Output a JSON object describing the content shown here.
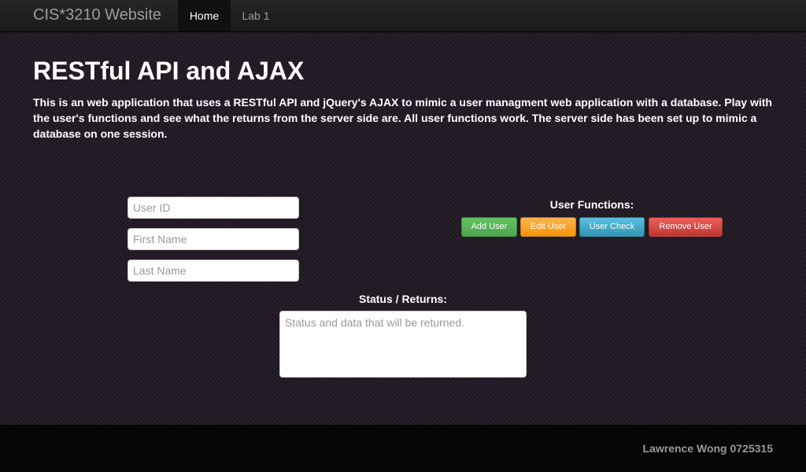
{
  "navbar": {
    "brand": "CIS*3210 Website",
    "items": [
      {
        "label": "Home",
        "active": true
      },
      {
        "label": "Lab 1",
        "active": false
      }
    ]
  },
  "main": {
    "title": "RESTful API and AJAX",
    "description": "This is an web application that uses a RESTful API and jQuery's AJAX to mimic a user managment web application with a database. Play with the user's functions and see what the returns from the server side are. All user functions work. The server side has been set up to mimic a database on one session."
  },
  "form": {
    "user_id": {
      "placeholder": "User ID",
      "value": ""
    },
    "first_name": {
      "placeholder": "First Name",
      "value": ""
    },
    "last_name": {
      "placeholder": "Last Name",
      "value": ""
    }
  },
  "user_functions": {
    "label": "User Functions:",
    "buttons": [
      {
        "label": "Add User",
        "color": "#5bb75b"
      },
      {
        "label": "Edit User",
        "color": "#faa732"
      },
      {
        "label": "User Check",
        "color": "#49afcd"
      },
      {
        "label": "Remove User",
        "color": "#da4f49"
      }
    ]
  },
  "status": {
    "label": "Status / Returns:",
    "placeholder": "Status and data that will be returned.",
    "value": ""
  },
  "footer": {
    "text": "Lawrence Wong 0725315"
  }
}
